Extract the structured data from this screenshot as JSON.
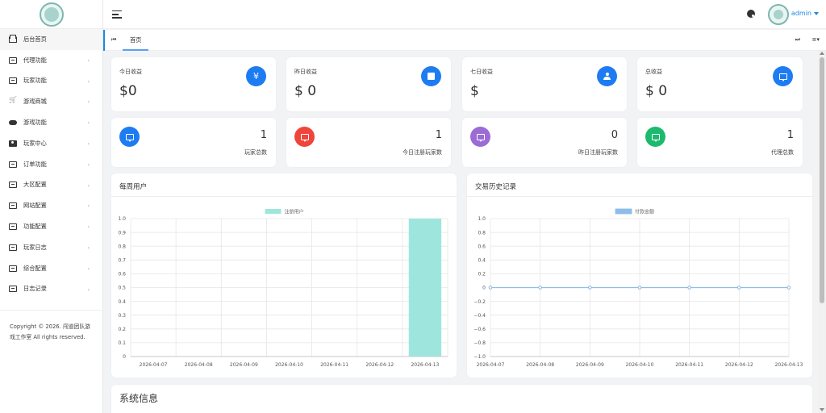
{
  "sidebar": {
    "items": [
      {
        "label": "后台首页",
        "icon": "home-icon",
        "active": true
      },
      {
        "label": "代理功能",
        "icon": "monitor-icon"
      },
      {
        "label": "玩家功能",
        "icon": "monitor-icon"
      },
      {
        "label": "游戏商城",
        "icon": "cart-icon"
      },
      {
        "label": "游戏功能",
        "icon": "gamepad-icon"
      },
      {
        "label": "玩家中心",
        "icon": "user-card-icon"
      },
      {
        "label": "订单功能",
        "icon": "monitor-icon"
      },
      {
        "label": "大区配置",
        "icon": "monitor-icon"
      },
      {
        "label": "网站配置",
        "icon": "monitor-icon"
      },
      {
        "label": "功能配置",
        "icon": "monitor-icon"
      },
      {
        "label": "玩家日志",
        "icon": "monitor-icon"
      },
      {
        "label": "综合配置",
        "icon": "monitor-icon"
      },
      {
        "label": "日志记录",
        "icon": "monitor-icon"
      }
    ],
    "copyright": "Copyright © 2026. 闯道团队游戏工作室 All rights reserved."
  },
  "header": {
    "username": "admin"
  },
  "tabs": {
    "home": "首页"
  },
  "stats": [
    {
      "label": "今日收益",
      "value": "$0",
      "icon": "yen-icon"
    },
    {
      "label": "昨日收益",
      "value": "$ 0",
      "icon": "bag-icon"
    },
    {
      "label": "七日收益",
      "value": "$",
      "icon": "person-icon"
    },
    {
      "label": "总收益",
      "value": "$ 0",
      "icon": "message-icon"
    }
  ],
  "counts": [
    {
      "value": "1",
      "label": "玩家总数",
      "color": "#1e7cf2"
    },
    {
      "value": "1",
      "label": "今日注册玩家数",
      "color": "#f0453a"
    },
    {
      "value": "0",
      "label": "昨日注册玩家数",
      "color": "#9b6bd6"
    },
    {
      "value": "1",
      "label": "代理总数",
      "color": "#1cba6e"
    }
  ],
  "panels": {
    "weekly": "每周用户",
    "history": "交易历史记录",
    "system": "系统信息"
  },
  "chart_data": [
    {
      "type": "bar",
      "title": "每周用户",
      "categories": [
        "2026-04-07",
        "2026-04-08",
        "2026-04-09",
        "2026-04-10",
        "2026-04-11",
        "2026-04-12",
        "2026-04-13"
      ],
      "series": [
        {
          "name": "注册用户",
          "values": [
            0,
            0,
            0,
            0,
            0,
            0,
            1
          ],
          "color": "#9ee6dd"
        }
      ],
      "ylim": [
        0,
        1.0
      ],
      "yticks": [
        "1.0",
        "0.9",
        "0.8",
        "0.7",
        "0.6",
        "0.5",
        "0.4",
        "0.3",
        "0.2",
        "0.1",
        "0"
      ],
      "grid": true,
      "legend": "top-center"
    },
    {
      "type": "line",
      "title": "交易历史记录",
      "categories": [
        "2026-04-07",
        "2026-04-08",
        "2026-04-09",
        "2026-04-10",
        "2026-04-11",
        "2026-04-12",
        "2026-04-13"
      ],
      "series": [
        {
          "name": "付款金额",
          "values": [
            0,
            0,
            0,
            0,
            0,
            0,
            0
          ],
          "color": "#8dbde8"
        }
      ],
      "ylim": [
        -1.0,
        1.0
      ],
      "yticks": [
        "1.0",
        "0.8",
        "0.6",
        "0.4",
        "0.2",
        "0",
        "−0.2",
        "−0.4",
        "−0.6",
        "−0.8",
        "−1.0"
      ],
      "grid": true,
      "legend": "top-center"
    }
  ]
}
